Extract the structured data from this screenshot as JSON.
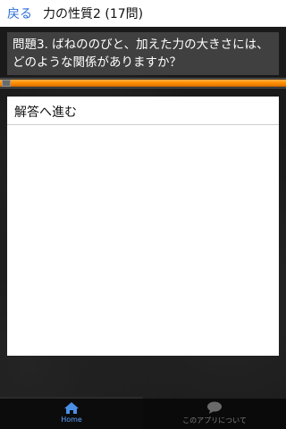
{
  "header": {
    "back_label": "戻る",
    "title": "力の性質2 (17問)"
  },
  "question": {
    "text": "問題3. ばねののびと、加えた力の大きさには、どのような関係がありますか？"
  },
  "progress": {
    "fraction": 1.0,
    "fill_color": "#ff8c00"
  },
  "answer_button": {
    "label": "解答へ進む"
  },
  "tabbar": {
    "tabs": [
      {
        "label": "Home",
        "icon": "home-icon",
        "active": true
      },
      {
        "label": "このアプリについて",
        "icon": "speech-bubble-icon",
        "active": false
      }
    ]
  },
  "colors": {
    "accent": "#2a6fd6",
    "tab_active": "#5aa0ff"
  }
}
